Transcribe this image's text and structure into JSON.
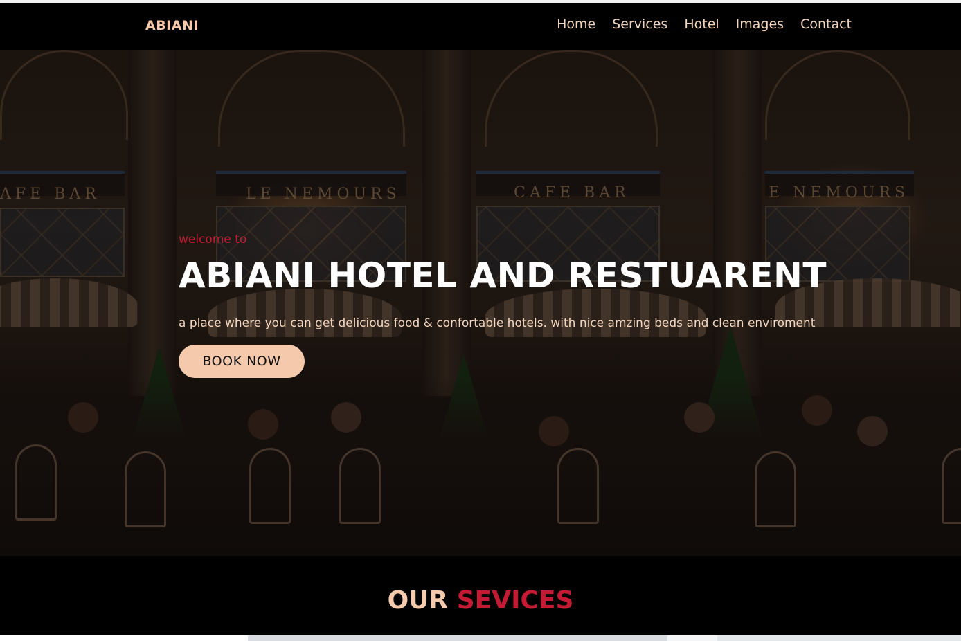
{
  "brand": "ABIANI",
  "nav": [
    "Home",
    "Services",
    "Hotel",
    "Images",
    "Contact"
  ],
  "hero": {
    "background_signs": [
      "AFE BAR",
      "LE NEMOURS",
      "CAFE BAR",
      "E NEMOURS"
    ],
    "welcome": "welcome to",
    "title": "ABIANI HOTEL AND RESTUARENT",
    "subtitle": "a place where you can get delicious food & confortable hotels. with nice amzing beds and clean enviroment",
    "button": "BOOK NOW"
  },
  "services": {
    "title_part1": "OUR",
    "title_part2": "SEVICES"
  },
  "colors": {
    "accent_red": "#c41a33",
    "peach": "#f4c9ac",
    "nav_text": "#f4d6bf"
  }
}
